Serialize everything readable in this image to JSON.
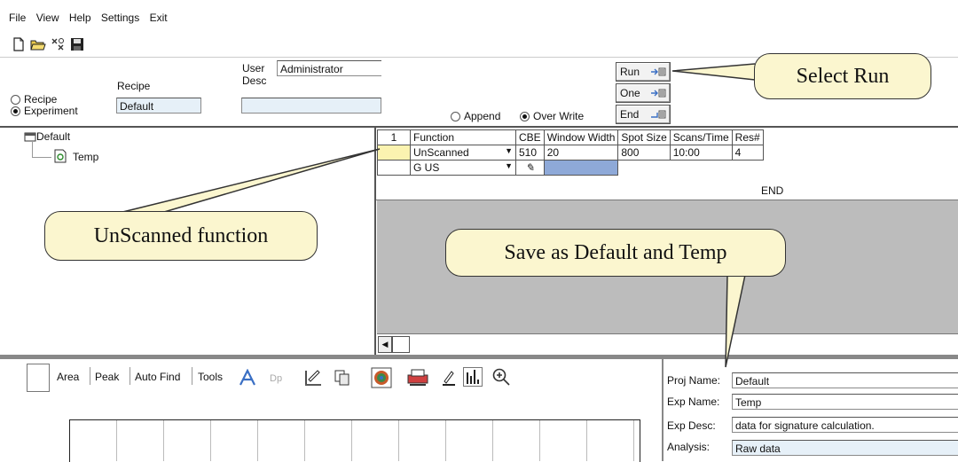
{
  "menu": {
    "file": "File",
    "view": "View",
    "help": "Help",
    "settings": "Settings",
    "exit": "Exit"
  },
  "toolbar": {
    "icons": [
      "new-icon",
      "open-icon",
      "connect-icon",
      "save-icon"
    ]
  },
  "header": {
    "recipe_radio": "Recipe",
    "experiment_radio": "Experiment",
    "recipe_label": "Recipe",
    "recipe_value": "Default",
    "user_label": "User",
    "desc_label": "Desc",
    "user_value": "Administrator",
    "desc_value": "",
    "append_label": "Append",
    "overwrite_label": "Over Write",
    "run_label": "Run",
    "one_label": "One",
    "end_label": "End"
  },
  "tree": {
    "root": "Default",
    "child": "Temp"
  },
  "grid": {
    "row_number": "1",
    "headers": [
      "Function",
      "CBE",
      "Window Width",
      "Spot Size",
      "Scans/Time",
      "Res#"
    ],
    "rows": [
      [
        "UnScanned",
        "510",
        "20",
        "800",
        "10:00",
        "4"
      ],
      [
        "G US",
        "",
        "",
        "",
        "",
        ""
      ]
    ],
    "end_label": "END"
  },
  "lower_toolbar": {
    "area": "Area",
    "peak": "Peak",
    "auto_find": "Auto Find",
    "tools": "Tools"
  },
  "project": {
    "proj_name_label": "Proj Name:",
    "proj_name_value": "Default",
    "exp_name_label": "Exp Name:",
    "exp_name_value": "Temp",
    "exp_desc_label": "Exp Desc:",
    "exp_desc_value": "data for signature calculation.",
    "analysis_label": "Analysis:",
    "analysis_value": "Raw data"
  },
  "callouts": {
    "select_run": "Select Run",
    "unscanned": "UnScanned function",
    "save_as": "Save as Default and Temp"
  },
  "colors": {
    "callout_fill": "#fbf6cf",
    "field_blue": "#e6f0f8",
    "selected_cell": "#fbf3b0",
    "grid_gray": "#bcbcbc"
  }
}
